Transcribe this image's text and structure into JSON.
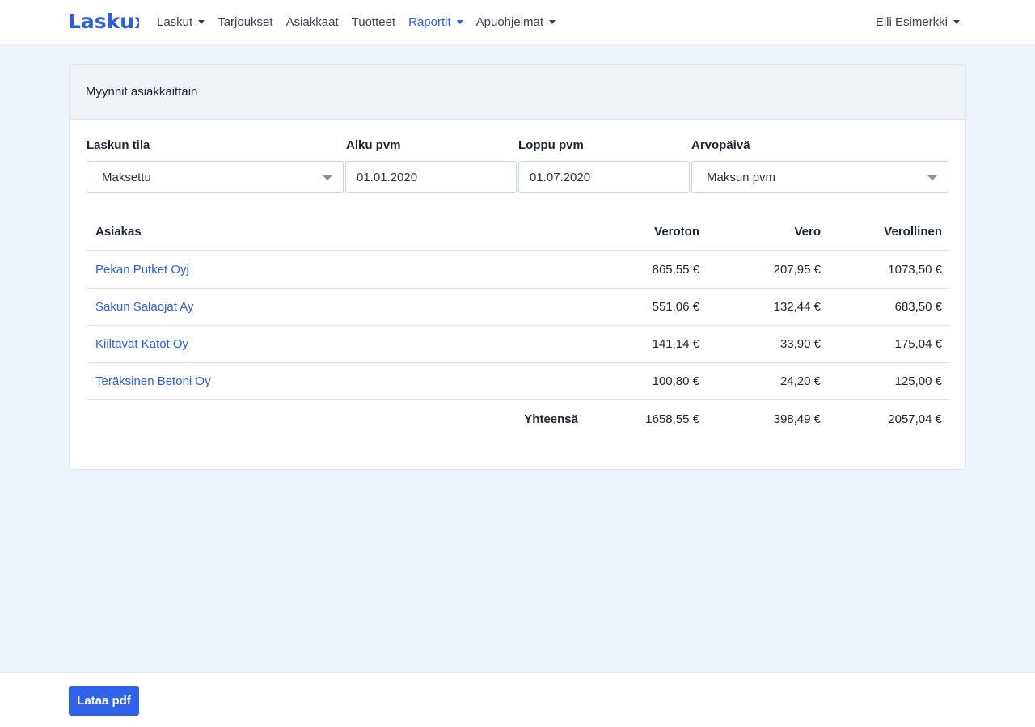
{
  "navbar": {
    "brand": "Laskux",
    "items": [
      {
        "label": "Laskut",
        "dropdown": true
      },
      {
        "label": "Tarjoukset",
        "dropdown": false
      },
      {
        "label": "Asiakkaat",
        "dropdown": false
      },
      {
        "label": "Tuotteet",
        "dropdown": false
      },
      {
        "label": "Raportit",
        "dropdown": true,
        "active": true
      },
      {
        "label": "Apuohjelmat",
        "dropdown": true
      }
    ],
    "user": "Elli Esimerkki"
  },
  "colors": {
    "accent": "#2e5fe0",
    "background": "#eef4fc",
    "button": "#2f62e8"
  },
  "report": {
    "title": "Myynnit asiakkaittain",
    "filters": {
      "status_label": "Laskun tila",
      "status_value": "Maksettu",
      "start_label": "Alku pvm",
      "start_value": "01.01.2020",
      "end_label": "Loppu pvm",
      "end_value": "01.07.2020",
      "valuedate_label": "Arvopäivä",
      "valuedate_value": "Maksun pvm"
    },
    "table": {
      "headers": {
        "customer": "Asiakas",
        "net": "Veroton",
        "vat": "Vero",
        "gross": "Verollinen"
      },
      "rows": [
        {
          "customer": "Pekan Putket Oyj",
          "net": "865,55 €",
          "vat": "207,95 €",
          "gross": "1073,50 €"
        },
        {
          "customer": "Sakun Salaojat Ay",
          "net": "551,06 €",
          "vat": "132,44 €",
          "gross": "683,50 €"
        },
        {
          "customer": "Kiiltävät Katot Oy",
          "net": "141,14 €",
          "vat": "33,90 €",
          "gross": "175,04 €"
        },
        {
          "customer": "Teräksinen Betoni Oy",
          "net": "100,80 €",
          "vat": "24,20 €",
          "gross": "125,00 €"
        }
      ],
      "total": {
        "label": "Yhteensä",
        "net": "1658,55 €",
        "vat": "398,49 €",
        "gross": "2057,04 €"
      }
    }
  },
  "footer": {
    "download_label": "Lataa pdf"
  }
}
